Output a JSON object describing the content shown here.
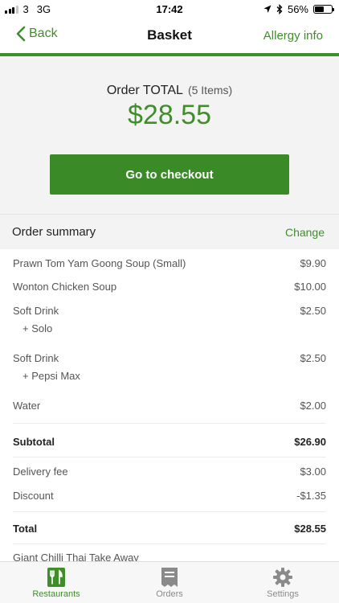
{
  "status_bar": {
    "carrier": "3",
    "network": "3G",
    "time": "17:42",
    "battery": "56%",
    "battery_level": 0.56
  },
  "nav": {
    "back_label": "Back",
    "title": "Basket",
    "right_label": "Allergy info",
    "accent_color": "#3f8e2a"
  },
  "order": {
    "total_label": "Order TOTAL",
    "items_label": "(5 Items)",
    "total_value": "$28.55",
    "checkout_label": "Go to checkout"
  },
  "summary": {
    "title": "Order summary",
    "change_label": "Change",
    "items": [
      {
        "name": "Prawn Tom Yam Goong Soup (Small)",
        "price": "$9.90",
        "option": ""
      },
      {
        "name": "Wonton Chicken Soup",
        "price": "$10.00",
        "option": ""
      },
      {
        "name": "Soft Drink",
        "price": "$2.50",
        "option": "+ Solo"
      },
      {
        "name": "Soft Drink",
        "price": "$2.50",
        "option": "+ Pepsi Max"
      },
      {
        "name": "Water",
        "price": "$2.00",
        "option": ""
      }
    ],
    "subtotal_label": "Subtotal",
    "subtotal_value": "$26.90",
    "delivery_label": "Delivery fee",
    "delivery_value": "$3.00",
    "discount_label": "Discount",
    "discount_value": "-$1.35",
    "total_label": "Total",
    "total_value": "$28.55",
    "restaurant_name": "Giant Chilli Thai Take Away"
  },
  "tabs": [
    {
      "label": "Restaurants",
      "icon": "restaurant-icon",
      "active": true
    },
    {
      "label": "Orders",
      "icon": "receipt-icon",
      "active": false
    },
    {
      "label": "Settings",
      "icon": "gear-icon",
      "active": false
    }
  ]
}
